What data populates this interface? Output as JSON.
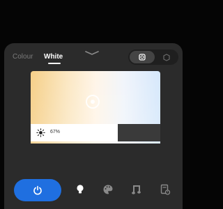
{
  "tabs": {
    "colour": "Colour",
    "white": "White"
  },
  "brightness": {
    "label": "67%",
    "level": 0.67
  },
  "colors": {
    "accent": "#1f6fe0",
    "sheet": "#2b2b2b"
  },
  "icons": {
    "handle": "chevron-down-icon",
    "mode_active": "rotate-icon",
    "mode_inactive": "cube-icon",
    "sun": "sun-icon",
    "power": "power-icon",
    "nav": [
      "bulb-icon",
      "palette-icon",
      "music-icon",
      "schedule-icon"
    ]
  }
}
